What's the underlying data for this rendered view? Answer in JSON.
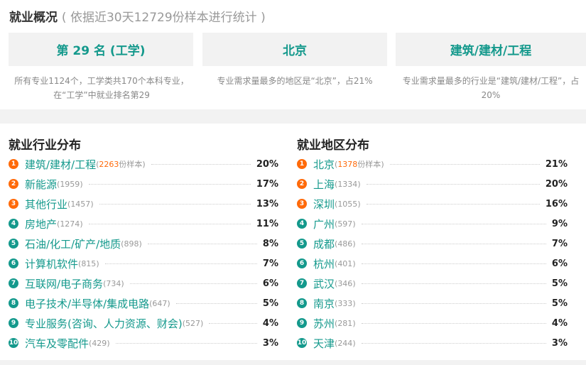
{
  "header": {
    "title": "就业概况",
    "subtitle": "( 依据近30天12729份样本进行统计 )"
  },
  "cards": [
    {
      "value": "第 29 名 (工学)",
      "desc": "所有专业1124个，工学类共170个本科专业，在“工学”中就业排名第29"
    },
    {
      "value": "北京",
      "desc": "专业需求量最多的地区是“北京”，占21%"
    },
    {
      "value": "建筑/建材/工程",
      "desc": "专业需求量最多的行业是“建筑/建材/工程”，占20%"
    }
  ],
  "industry": {
    "title": "就业行业分布",
    "sample_suffix": "份样本",
    "items": [
      {
        "rank": "1",
        "name": "建筑/建材/工程",
        "count": "2263",
        "pct": "20%"
      },
      {
        "rank": "2",
        "name": "新能源",
        "count": "1959",
        "pct": "17%"
      },
      {
        "rank": "3",
        "name": "其他行业",
        "count": "1457",
        "pct": "13%"
      },
      {
        "rank": "4",
        "name": "房地产",
        "count": "1274",
        "pct": "11%"
      },
      {
        "rank": "5",
        "name": "石油/化工/矿产/地质",
        "count": "898",
        "pct": "8%"
      },
      {
        "rank": "6",
        "name": "计算机软件",
        "count": "815",
        "pct": "7%"
      },
      {
        "rank": "7",
        "name": "互联网/电子商务",
        "count": "734",
        "pct": "6%"
      },
      {
        "rank": "8",
        "name": "电子技术/半导体/集成电路",
        "count": "647",
        "pct": "5%"
      },
      {
        "rank": "9",
        "name": "专业服务(咨询、人力资源、财会)",
        "count": "527",
        "pct": "4%"
      },
      {
        "rank": "10",
        "name": "汽车及零配件",
        "count": "429",
        "pct": "3%"
      }
    ]
  },
  "region": {
    "title": "就业地区分布",
    "sample_suffix": "份样本",
    "items": [
      {
        "rank": "1",
        "name": "北京",
        "count": "1378",
        "pct": "21%"
      },
      {
        "rank": "2",
        "name": "上海",
        "count": "1334",
        "pct": "20%"
      },
      {
        "rank": "3",
        "name": "深圳",
        "count": "1055",
        "pct": "16%"
      },
      {
        "rank": "4",
        "name": "广州",
        "count": "597",
        "pct": "9%"
      },
      {
        "rank": "5",
        "name": "成都",
        "count": "486",
        "pct": "7%"
      },
      {
        "rank": "6",
        "name": "杭州",
        "count": "401",
        "pct": "6%"
      },
      {
        "rank": "7",
        "name": "武汉",
        "count": "346",
        "pct": "5%"
      },
      {
        "rank": "8",
        "name": "南京",
        "count": "333",
        "pct": "5%"
      },
      {
        "rank": "9",
        "name": "苏州",
        "count": "281",
        "pct": "4%"
      },
      {
        "rank": "10",
        "name": "天津",
        "count": "244",
        "pct": "3%"
      }
    ]
  },
  "colors": {
    "accent": "#14998c",
    "hot": "#ff6a0a"
  }
}
